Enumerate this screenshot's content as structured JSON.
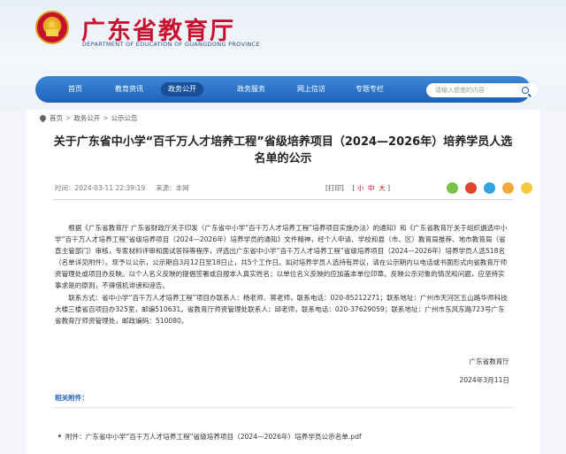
{
  "header": {
    "site_title": "广东省教育厅",
    "site_subtitle": "DEPARTMENT OF EDUCATION OF GUANGDONG PROVINCE",
    "emblem_icon": "national-emblem-icon"
  },
  "nav": {
    "items": [
      {
        "label": "首页"
      },
      {
        "label": "教育资讯"
      },
      {
        "label": "政务公开",
        "active": true
      },
      {
        "label": "政务服务"
      },
      {
        "label": "网上信访"
      },
      {
        "label": "专题专栏"
      }
    ],
    "search_placeholder": "请输入想查的内容",
    "active_color": "#184f99"
  },
  "breadcrumb": [
    "首页",
    "政务公开",
    "公示公告"
  ],
  "article": {
    "title": "关于广东省中小学“百千万人才培养工程”省级培养项目（2024—2026年）培养学员人选名单的公示",
    "time": "时间：2024-03-11 22:39:19",
    "source": "来源：本网",
    "print": "[打印]",
    "size_small": "小",
    "size_medium": "中",
    "size_large": "大",
    "paragraph": "根据《广东省教育厅 广东省财政厅关于印发〈广东省中小学“百千万人才培养工程”培养项目实施办法〉的通知》和《广东省教育厅关于组织遴选中小学“百千万人才培养工程”省级培养项目（2024—2026年）培养学员的通知》文件精神，经个人申请、学校和县（市、区）教育局推荐、地市教育局（省直主管部门）审核，专家材料评审和面试答辩等程序，评选出广东省中小学“百千万人才培养工程”省级培养项目（2024—2026年）培养学员人选518名（名单详见附件）。现予以公示，公示期自3月12日至18日止，共5个工作日。如对培养学员人选持有异议，请在公示期内以电话或书面形式向省教育厅师资管理处或项目办反映。以个人名义反映的提倡签署或自报本人真实姓名；以单位名义反映的应加盖本单位印章。反映公示对象的情况和问题，应坚持实事求是的原则，不得借机诽谤和诬告。",
    "contact": "联系方式：省中小学“百千万人才培养工程”项目办联系人：杨老师、蒋老师，联系电话：020-85212271；联系地址：广州市天河区五山路华师科技大楼三楼省百项目办325室，邮编510631。省教育厅师资管理处联系人：邱老师，联系电话：020-37629059；联系地址：广州市东风东路723号广东省教育厅师资管理处，邮政编码：510080。",
    "signature": "广东省教育厅",
    "date": "2024年3月11日",
    "attach_label": "相关附件：",
    "attachment": "附件：广东省中小学“百千万人才培养工程”省级培养项目（2024—2026年）培养学员公示名单.pdf"
  },
  "share_colors": [
    "#7bc04a",
    "#e0442f",
    "#38a1e0",
    "#f0a93b",
    "#f5c842"
  ]
}
